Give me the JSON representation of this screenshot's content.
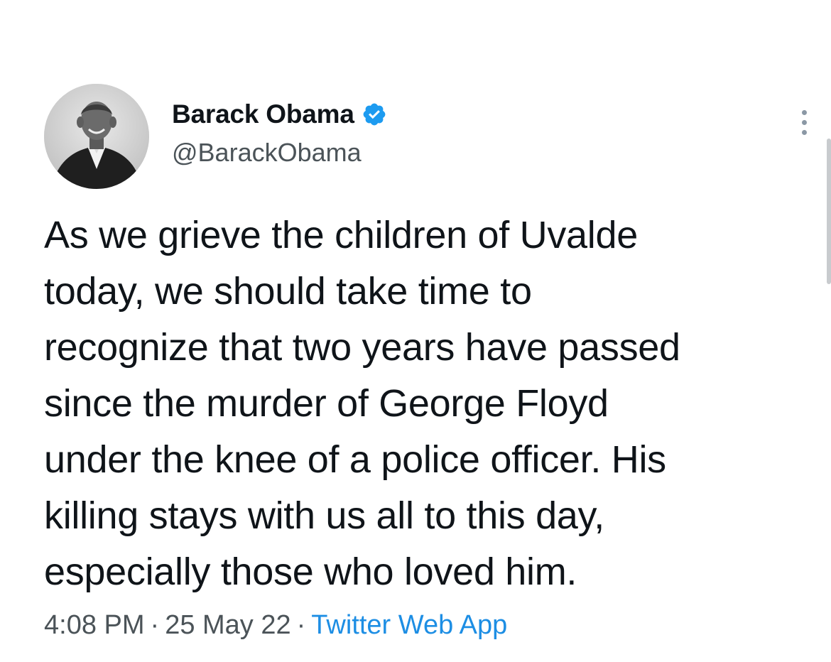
{
  "tweet": {
    "author": {
      "display_name": "Barack Obama",
      "handle": "@BarackObama",
      "verified": true
    },
    "text_lines": [
      "As we grieve the children of Uvalde",
      "today, we should take time to",
      "recognize that two years have passed",
      "since the murder of George Floyd",
      "under the knee of a police officer. His",
      "killing stays with us all to this day,",
      "especially those who loved him."
    ],
    "time": "4:08 PM",
    "separator": "·",
    "date": "25 May 22",
    "source": "Twitter Web App"
  },
  "icons": {
    "verified": "verified-badge-icon",
    "more": "more-options-icon"
  },
  "colors": {
    "verified_blue": "#1d9bf0",
    "link_blue": "#1d8ee4",
    "muted_text": "#4b5358",
    "main_text": "#0f1419"
  }
}
